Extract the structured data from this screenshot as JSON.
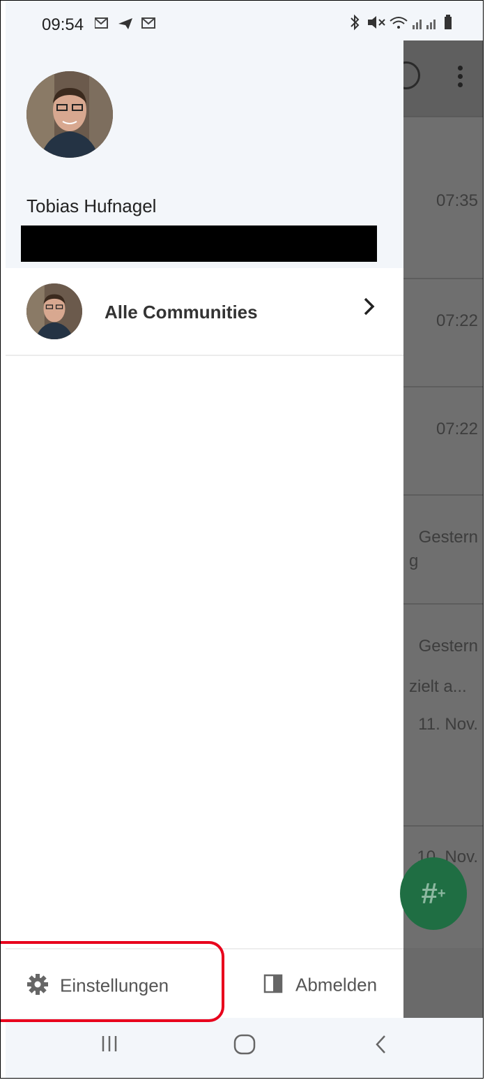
{
  "status_bar": {
    "time": "09:54",
    "left_icons": "M ➤ M",
    "right_icons": "✱ 🔇 WiFi ||| ||| ▮"
  },
  "drawer": {
    "user_name": "Tobias Hufnagel",
    "community_label": "Alle Communities",
    "settings_label": "Einstellungen",
    "logout_label": "Abmelden"
  },
  "background": {
    "times": [
      "07:35",
      "07:22",
      "07:22",
      "Gestern",
      "Gestern",
      "11. Nov.",
      "10. Nov."
    ],
    "snippets": [
      "",
      "",
      "",
      "g",
      "zielt a...",
      "",
      ""
    ],
    "fab_label": "#"
  },
  "nav": {
    "recent": "|||",
    "home": "○",
    "back": "‹"
  },
  "colors": {
    "highlight": "#e8001c",
    "fab": "#1f6e43",
    "header_bg": "#f3f6fa"
  }
}
